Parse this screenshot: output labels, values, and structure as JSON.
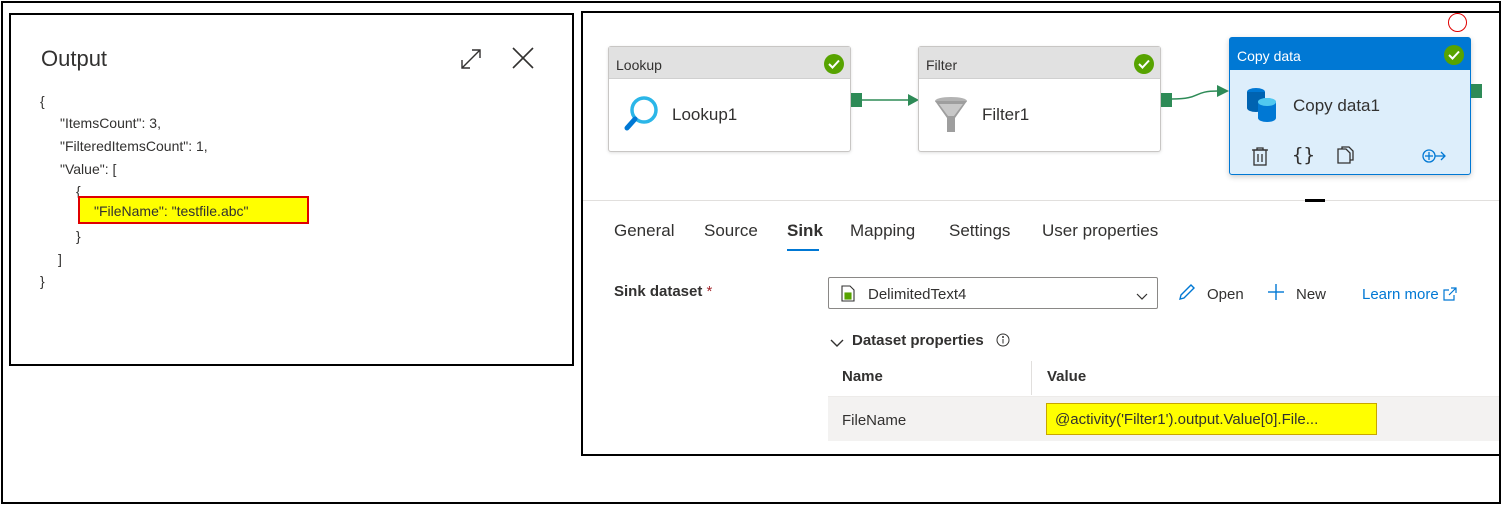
{
  "output": {
    "title": "Output",
    "json_lines": [
      "{",
      "\"ItemsCount\": 3,",
      "\"FilteredItemsCount\": 1,",
      "\"Value\": [",
      "{",
      "\"FileName\": \"testfile.abc\"",
      "}",
      "]",
      "}"
    ],
    "highlight_color": "#ffff00",
    "highlight_border": "#e00000"
  },
  "pipeline": {
    "activities": [
      {
        "type": "Lookup",
        "name": "Lookup1",
        "icon": "search-icon",
        "status": "succeeded"
      },
      {
        "type": "Filter",
        "name": "Filter1",
        "icon": "filter-icon",
        "status": "succeeded"
      },
      {
        "type": "Copy data",
        "name": "Copy data1",
        "icon": "database-icon",
        "status": "succeeded",
        "selected": true
      }
    ],
    "success_color": "#57a300",
    "connector_color": "#2e8b57",
    "accent": "#0078d4"
  },
  "tabs": [
    "General",
    "Source",
    "Sink",
    "Mapping",
    "Settings",
    "User properties"
  ],
  "active_tab": "Sink",
  "sink": {
    "label": "Sink dataset",
    "required_mark": "*",
    "dataset_value": "DelimitedText4",
    "open_label": "Open",
    "new_label": "New",
    "learn_more_label": "Learn more",
    "dataset_properties_label": "Dataset properties",
    "columns": [
      "Name",
      "Value"
    ],
    "rows": [
      {
        "name": "FileName",
        "value": "@activity('Filter1').output.Value[0].File..."
      }
    ],
    "value_highlight_color": "#ffff00"
  }
}
